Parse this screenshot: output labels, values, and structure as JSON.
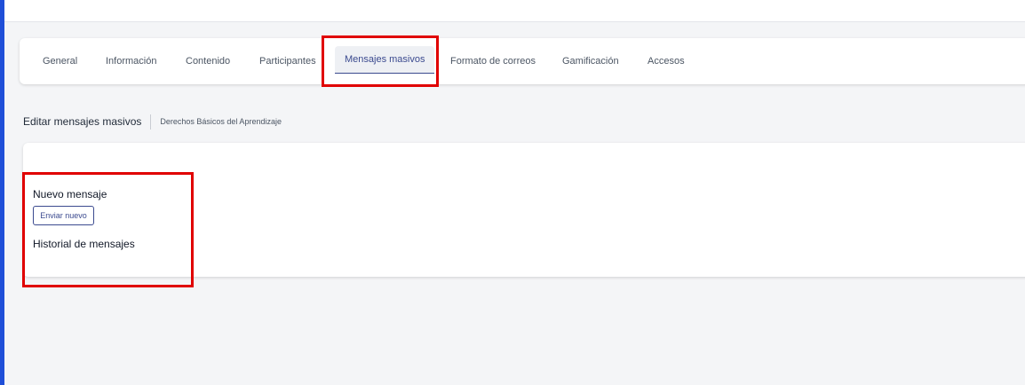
{
  "tabs": [
    {
      "label": "General",
      "active": false
    },
    {
      "label": "Información",
      "active": false
    },
    {
      "label": "Contenido",
      "active": false
    },
    {
      "label": "Participantes",
      "active": false
    },
    {
      "label": "Mensajes masivos",
      "active": true
    },
    {
      "label": "Formato de correos",
      "active": false
    },
    {
      "label": "Gamificación",
      "active": false
    },
    {
      "label": "Accesos",
      "active": false
    }
  ],
  "breadcrumb": {
    "title": "Editar mensajes masivos",
    "subtitle": "Derechos Básicos del Aprendizaje"
  },
  "content": {
    "new_message_title": "Nuevo mensaje",
    "send_new_label": "Enviar nuevo",
    "history_title": "Historial de mensajes"
  },
  "colors": {
    "accent": "#1f4fd8",
    "primary_text": "#3b4a8f",
    "highlight": "#e00000"
  }
}
